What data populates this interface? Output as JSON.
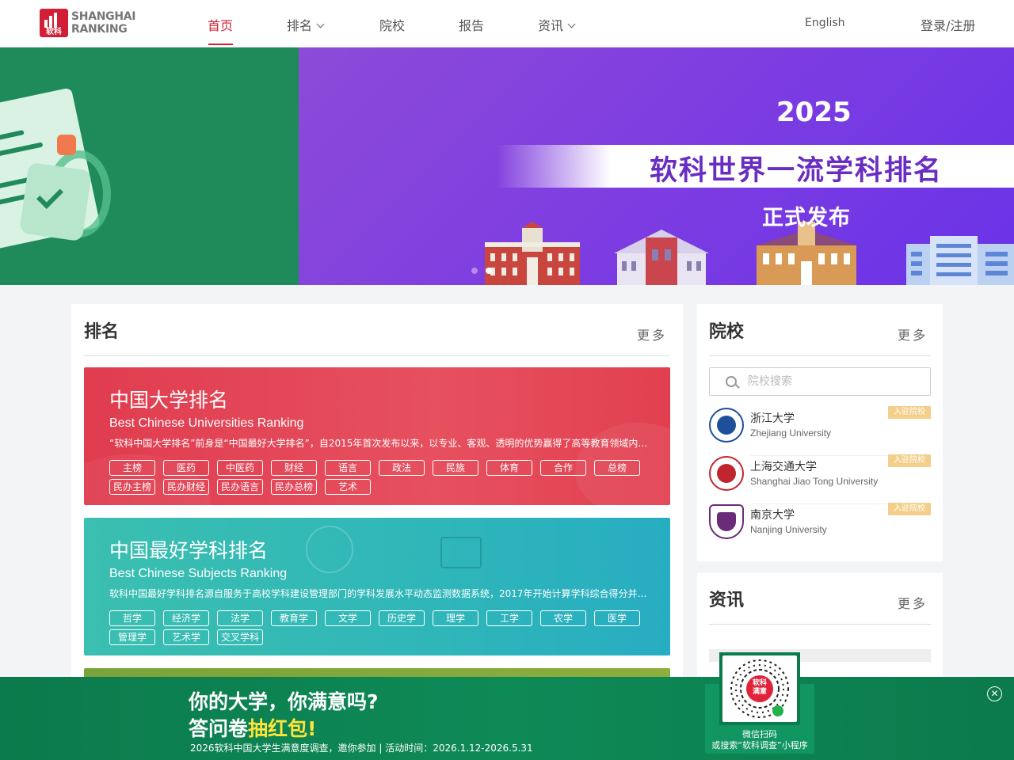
{
  "header": {
    "logo_cn": "软科",
    "logo_line1": "SHANGHAI",
    "logo_line2": "RANKING",
    "nav": [
      {
        "label": "首页",
        "active": true
      },
      {
        "label": "排名",
        "dropdown": true
      },
      {
        "label": "院校"
      },
      {
        "label": "报告"
      },
      {
        "label": "资讯",
        "dropdown": true
      }
    ],
    "language": "English",
    "login": "登录/注册"
  },
  "banner": {
    "year": "2025",
    "title": "软科世界一流学科排名",
    "subtitle": "正式发布",
    "slides_total": 2,
    "slide_active": 2,
    "colors": {
      "purple": "#7f3ee0",
      "green": "#1f8a5a"
    }
  },
  "ranking": {
    "title": "排名",
    "more": "更多",
    "cards": [
      {
        "cn": "中国大学排名",
        "en": "Best Chinese Universities Ranking",
        "desc": "“软科中国大学排名”前身是“中国最好大学排名”，自2015年首次发布以来，以专业、客观、透明的优势赢得了高等教育领域内外的广泛关注和认可",
        "tags": [
          "主榜",
          "医药",
          "中医药",
          "财经",
          "语言",
          "政法",
          "民族",
          "体育",
          "合作",
          "总榜",
          "民办主榜",
          "民办财经",
          "民办语言",
          "民办总榜",
          "艺术"
        ],
        "color": "#e23d52"
      },
      {
        "cn": "中国最好学科排名",
        "en": "Best Chinese Subjects Ranking",
        "desc": "软科中国最好学科排名源自服务于高校学科建设管理部门的学科发展水平动态监测数据系统，2017年开始计算学科综合得分并公开发布",
        "tags": [
          "哲学",
          "经济学",
          "法学",
          "教育学",
          "文学",
          "历史学",
          "理学",
          "工学",
          "农学",
          "医学",
          "管理学",
          "艺术学",
          "交叉学科"
        ],
        "color": "#2fb8b6"
      }
    ]
  },
  "schools": {
    "title": "院校",
    "more": "更多",
    "search_placeholder": "院校搜索",
    "items": [
      {
        "cn": "浙江大学",
        "en": "Zhejiang University",
        "badge": "入驻院校",
        "color": "#1d4f9a"
      },
      {
        "cn": "上海交通大学",
        "en": "Shanghai Jiao Tong University",
        "badge": "入驻院校",
        "color": "#c0262d"
      },
      {
        "cn": "南京大学",
        "en": "Nanjing University",
        "badge": "入驻院校",
        "color": "#6a2c78"
      }
    ]
  },
  "news": {
    "title": "资讯",
    "more": "更多"
  },
  "promo": {
    "line1": "你的大学，你满意吗?",
    "line2_prefix": "答问卷",
    "line2_highlight": "抽红包!",
    "line3": "2026软科中国大学生满意度调查，邀你参加 | 活动时间：2026.1.12-2026.5.31",
    "qr_badge": "软科\n满意",
    "qr_caption1": "微信扫码",
    "qr_caption2": "或搜索“软科调查”小程序"
  }
}
